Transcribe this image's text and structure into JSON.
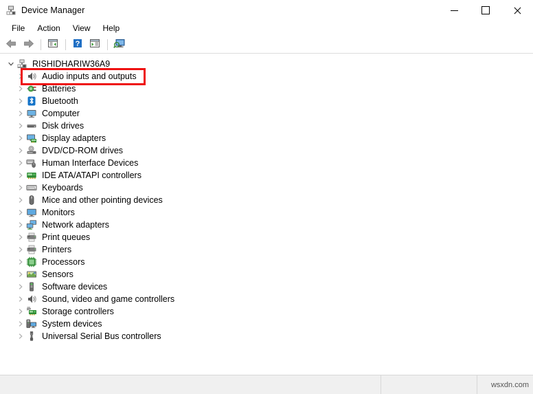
{
  "window": {
    "title": "Device Manager",
    "icon": "device-manager-icon",
    "controls": {
      "minimize": "minimize-icon",
      "maximize": "maximize-icon",
      "close": "close-icon"
    }
  },
  "menubar": {
    "items": [
      {
        "label": "File",
        "name": "menu-file"
      },
      {
        "label": "Action",
        "name": "menu-action"
      },
      {
        "label": "View",
        "name": "menu-view"
      },
      {
        "label": "Help",
        "name": "menu-help"
      }
    ]
  },
  "toolbar": {
    "buttons": [
      {
        "name": "back-button",
        "icon": "back-arrow-icon"
      },
      {
        "name": "forward-button",
        "icon": "forward-arrow-icon"
      },
      {
        "name": "properties-button",
        "icon": "properties-icon"
      },
      {
        "name": "help-button",
        "icon": "help-question-icon"
      },
      {
        "name": "update-driver-button",
        "icon": "update-driver-icon"
      },
      {
        "name": "scan-hardware-button",
        "icon": "scan-hardware-icon"
      }
    ]
  },
  "tree": {
    "root": {
      "label": "RISHIDHARIW36A9",
      "icon": "computer-root-icon",
      "expanded": true
    },
    "items": [
      {
        "label": "Audio inputs and outputs",
        "icon": "speaker-icon",
        "highlighted": true
      },
      {
        "label": "Batteries",
        "icon": "battery-icon",
        "highlighted": false
      },
      {
        "label": "Bluetooth",
        "icon": "bluetooth-icon",
        "highlighted": false
      },
      {
        "label": "Computer",
        "icon": "computer-icon",
        "highlighted": false
      },
      {
        "label": "Disk drives",
        "icon": "disk-drive-icon",
        "highlighted": false
      },
      {
        "label": "Display adapters",
        "icon": "display-adapter-icon",
        "highlighted": false
      },
      {
        "label": "DVD/CD-ROM drives",
        "icon": "dvd-drive-icon",
        "highlighted": false
      },
      {
        "label": "Human Interface Devices",
        "icon": "hid-icon",
        "highlighted": false
      },
      {
        "label": "IDE ATA/ATAPI controllers",
        "icon": "ide-controller-icon",
        "highlighted": false
      },
      {
        "label": "Keyboards",
        "icon": "keyboard-icon",
        "highlighted": false
      },
      {
        "label": "Mice and other pointing devices",
        "icon": "mouse-icon",
        "highlighted": false
      },
      {
        "label": "Monitors",
        "icon": "monitor-icon",
        "highlighted": false
      },
      {
        "label": "Network adapters",
        "icon": "network-adapter-icon",
        "highlighted": false
      },
      {
        "label": "Print queues",
        "icon": "print-queue-icon",
        "highlighted": false
      },
      {
        "label": "Printers",
        "icon": "printer-icon",
        "highlighted": false
      },
      {
        "label": "Processors",
        "icon": "processor-icon",
        "highlighted": false
      },
      {
        "label": "Sensors",
        "icon": "sensor-icon",
        "highlighted": false
      },
      {
        "label": "Software devices",
        "icon": "software-device-icon",
        "highlighted": false
      },
      {
        "label": "Sound, video and game controllers",
        "icon": "speaker-icon",
        "highlighted": false
      },
      {
        "label": "Storage controllers",
        "icon": "storage-controller-icon",
        "highlighted": false
      },
      {
        "label": "System devices",
        "icon": "system-device-icon",
        "highlighted": false
      },
      {
        "label": "Universal Serial Bus controllers",
        "icon": "usb-icon",
        "highlighted": false
      }
    ]
  },
  "statusbar": {
    "pane1": "",
    "pane2": "",
    "watermark": "wsxdn.com"
  },
  "colors": {
    "highlight": "#ee1111",
    "window_bg": "#ffffff",
    "statusbar_bg": "#f0f0f0"
  }
}
